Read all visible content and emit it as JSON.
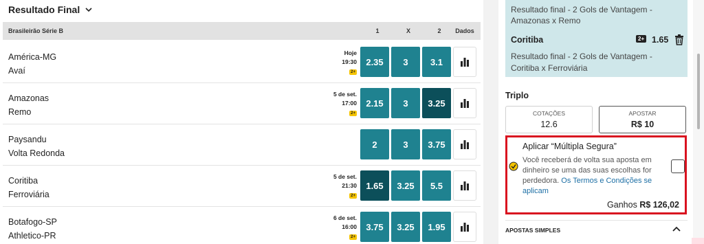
{
  "section_title": "Resultado Final",
  "league": {
    "name": "Brasileirão Série B",
    "cols": [
      "1",
      "X",
      "2",
      "Dados"
    ]
  },
  "matches": [
    {
      "home": "América-MG",
      "away": "Avaí",
      "date": "Hoje",
      "time": "19:30",
      "badge": "2+",
      "odds": [
        "2.35",
        "3",
        "3.1"
      ],
      "selected": -1
    },
    {
      "home": "Amazonas",
      "away": "Remo",
      "date": "5 de set.",
      "time": "17:00",
      "badge": "2+",
      "odds": [
        "2.15",
        "3",
        "3.25"
      ],
      "selected": 2
    },
    {
      "home": "Paysandu",
      "away": "Volta Redonda",
      "date": "",
      "time": "",
      "badge": "",
      "odds": [
        "2",
        "3",
        "3.75"
      ],
      "selected": -1
    },
    {
      "home": "Coritiba",
      "away": "Ferroviária",
      "date": "5 de set.",
      "time": "21:30",
      "badge": "2+",
      "odds": [
        "1.65",
        "3.25",
        "5.5"
      ],
      "selected": 0
    },
    {
      "home": "Botafogo-SP",
      "away": "Athletico-PR",
      "date": "6 de set.",
      "time": "16:00",
      "badge": "2+",
      "odds": [
        "3.75",
        "3.25",
        "1.95"
      ],
      "selected": -1
    }
  ],
  "betslip": {
    "prev_desc_1": "Resultado final - 2 Gols de Vantagem -",
    "prev_desc_2": "Amazonas x Remo",
    "selection_team": "Coritiba",
    "selection_badge": "2+",
    "selection_odds": "1.65",
    "selection_desc_1": "Resultado final - 2 Gols de Vantagem -",
    "selection_desc_2": "Coritiba x Ferroviária",
    "bet_type": "Triplo",
    "cotacoes_label": "COTAÇÕES",
    "cotacoes_value": "12.6",
    "apostar_label": "APOSTAR",
    "apostar_value": "R$ 10",
    "multipla": {
      "title": "Aplicar “Múltipla Segura”",
      "text_1": "Você receberá de volta sua aposta em",
      "text_2": "dinheiro se uma das suas escolhas for",
      "text_3": "perdedora.",
      "link_1": "Os Termos e Condições se",
      "link_2": "aplicam",
      "gain_label": "Ganhos",
      "gain_value": "R$ 126,02"
    },
    "simples_label": "APOSTAS SIMPLES"
  }
}
